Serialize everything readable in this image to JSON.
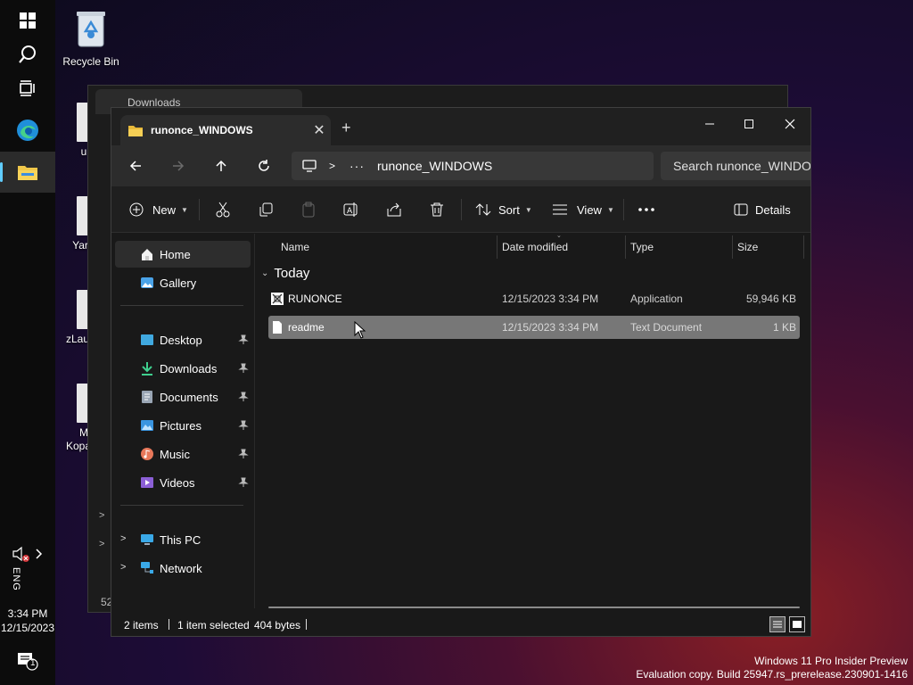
{
  "desktop": {
    "recycle_bin_label": "Recycle Bin",
    "stub_labels": [
      "u",
      "Yar",
      "zLau",
      "M",
      "Kopa"
    ]
  },
  "taskbar": {
    "time": "3:34 PM",
    "date": "12/15/2023",
    "language": "ENG",
    "notification_count": "1"
  },
  "background_window": {
    "tab_title": "Downloads",
    "status_fragment": "52"
  },
  "window": {
    "tab_title": "runonce_WINDOWS",
    "address_path": "runonce_WINDOWS",
    "search_placeholder": "Search runonce_WINDOWS",
    "toolbar": {
      "new_label": "New",
      "sort_label": "Sort",
      "view_label": "View",
      "details_label": "Details"
    },
    "sidebar": {
      "top_items": [
        {
          "label": "Home",
          "icon": "home-icon"
        },
        {
          "label": "Gallery",
          "icon": "gallery-icon"
        }
      ],
      "pinned_items": [
        {
          "label": "Desktop",
          "icon": "desktop-icon"
        },
        {
          "label": "Downloads",
          "icon": "downloads-icon"
        },
        {
          "label": "Documents",
          "icon": "documents-icon"
        },
        {
          "label": "Pictures",
          "icon": "pictures-icon"
        },
        {
          "label": "Music",
          "icon": "music-icon"
        },
        {
          "label": "Videos",
          "icon": "videos-icon"
        }
      ],
      "tree_items": [
        {
          "label": "This PC",
          "icon": "this-pc-icon"
        },
        {
          "label": "Network",
          "icon": "network-icon"
        }
      ]
    },
    "columns": {
      "name": "Name",
      "date_modified": "Date modified",
      "type": "Type",
      "size": "Size"
    },
    "group_label": "Today",
    "files": [
      {
        "name": "RUNONCE",
        "date": "12/15/2023 3:34 PM",
        "type": "Application",
        "size": "59,946 KB",
        "icon": "application-icon",
        "selected": false
      },
      {
        "name": "readme",
        "date": "12/15/2023 3:34 PM",
        "type": "Text Document",
        "size": "1 KB",
        "icon": "text-document-icon",
        "selected": true
      }
    ],
    "status": {
      "item_count": "2 items",
      "selection": "1 item selected",
      "size": "404 bytes"
    }
  },
  "watermark": {
    "line1": "Windows 11 Pro Insider Preview",
    "line2": "Evaluation copy. Build 25947.rs_prerelease.230901-1416"
  },
  "colors": {
    "accent": "#60cdff",
    "selected_row": "#777777",
    "window_bg": "#191919",
    "folder": "#f0c74a"
  }
}
